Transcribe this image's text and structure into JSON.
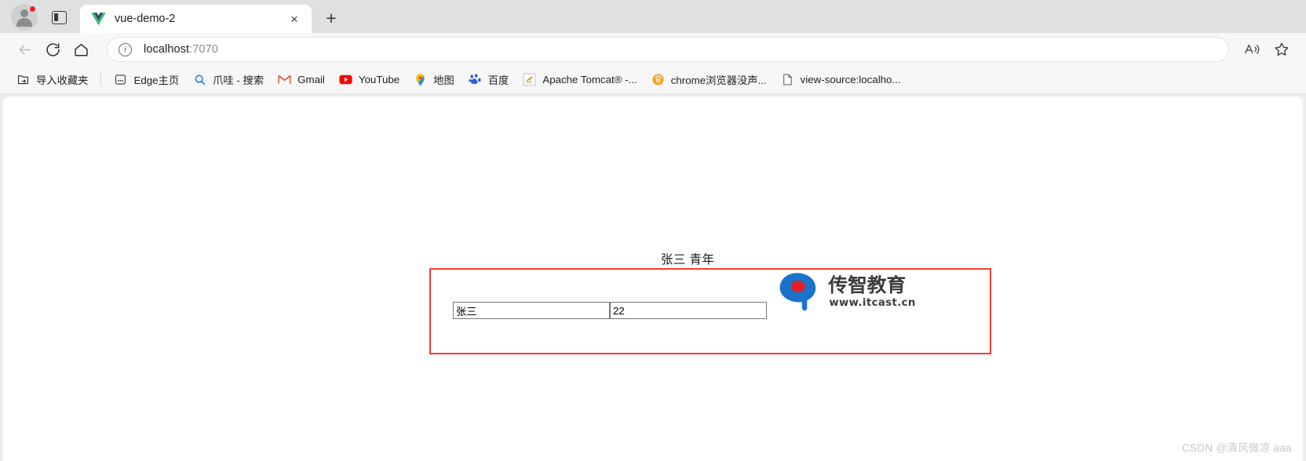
{
  "browser": {
    "tab": {
      "title": "vue-demo-2",
      "favicon": "vue-logo-icon",
      "close_label": "×"
    },
    "new_tab_label": "+",
    "toolbar": {
      "back_icon": "back-arrow-icon",
      "reload_icon": "reload-icon",
      "home_icon": "home-icon",
      "site_info_icon": "info-icon",
      "site_info_glyph": "i",
      "url_host": "localhost",
      "url_port": ":7070",
      "read_aloud_icon": "read-aloud-icon",
      "favorite_icon": "star-icon"
    },
    "bookmarks": [
      {
        "label": "导入收藏夹",
        "icon": "import-favorites-icon"
      },
      {
        "label": "Edge主页",
        "icon": "edge-home-icon"
      },
      {
        "label": "爪哇 - 搜索",
        "icon": "search-icon"
      },
      {
        "label": "Gmail",
        "icon": "gmail-icon"
      },
      {
        "label": "YouTube",
        "icon": "youtube-icon"
      },
      {
        "label": "地图",
        "icon": "maps-pin-icon"
      },
      {
        "label": "百度",
        "icon": "baidu-icon"
      },
      {
        "label": "Apache Tomcat® -...",
        "icon": "tomcat-icon"
      },
      {
        "label": "chrome浏览器没声...",
        "icon": "chrome-note-icon"
      },
      {
        "label": "view-source:localho...",
        "icon": "page-icon"
      }
    ]
  },
  "page": {
    "heading": "张三 青年",
    "logo": {
      "brand": "传智教育",
      "url": "www.itcast.cn"
    },
    "form": {
      "name_value": "张三",
      "age_value": "22"
    },
    "watermark": "CSDN @清风微凉 aaa"
  },
  "colors": {
    "accent_red": "#f53c36",
    "logo_blue": "#1a73c8",
    "logo_red": "#e01f26"
  }
}
